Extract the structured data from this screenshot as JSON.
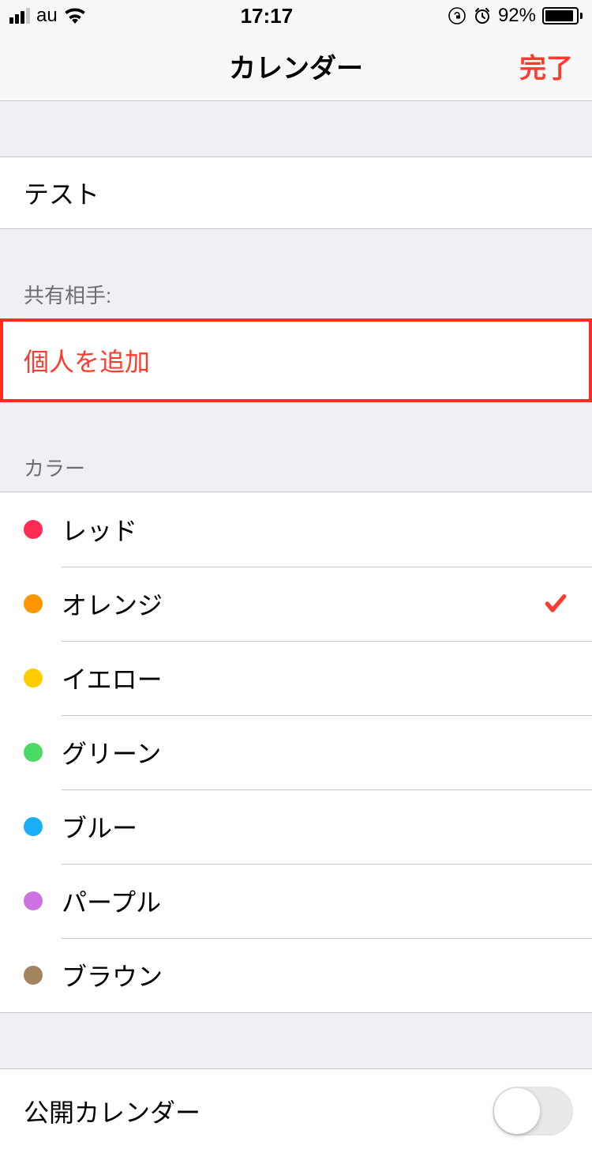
{
  "status": {
    "carrier": "au",
    "time": "17:17",
    "battery_percent": "92%"
  },
  "nav": {
    "title": "カレンダー",
    "done_label": "完了"
  },
  "calendar_name": {
    "value": "テスト"
  },
  "share": {
    "header": "共有相手:",
    "add_person_label": "個人を追加"
  },
  "color_section": {
    "header": "カラー",
    "selected_index": 1,
    "options": [
      {
        "label": "レッド",
        "hex": "#ff2d55"
      },
      {
        "label": "オレンジ",
        "hex": "#ff9500"
      },
      {
        "label": "イエロー",
        "hex": "#ffcc00"
      },
      {
        "label": "グリーン",
        "hex": "#4cd964"
      },
      {
        "label": "ブルー",
        "hex": "#1badf8"
      },
      {
        "label": "パープル",
        "hex": "#cc73e1"
      },
      {
        "label": "ブラウン",
        "hex": "#a2845e"
      }
    ]
  },
  "public_calendar": {
    "label": "公開カレンダー",
    "enabled": false
  }
}
